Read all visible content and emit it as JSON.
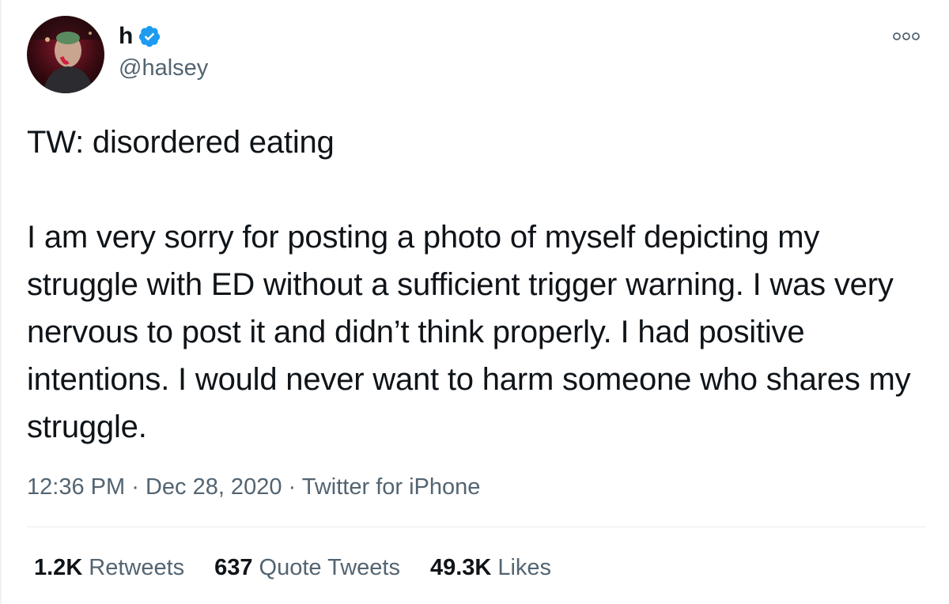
{
  "author": {
    "display_name": "h",
    "handle": "@halsey",
    "verified": true,
    "verified_color": "#1d9bf0",
    "avatar": "profile-photo"
  },
  "tweet": {
    "text": "TW: disordered eating\n\nI am very sorry for posting a photo of myself depicting my struggle with ED without a sufficient trigger warning. I was very nervous to post it and didn’t think properly. I had positive intentions. I would never want to harm someone who shares my struggle.",
    "time": "12:36 PM",
    "separator": "·",
    "date": "Dec 28, 2020",
    "source": "Twitter for iPhone"
  },
  "stats": {
    "retweets_count": "1.2K",
    "retweets_label": "Retweets",
    "quote_count": "637",
    "quote_label": "Quote Tweets",
    "likes_count": "49.3K",
    "likes_label": "Likes"
  },
  "icons": {
    "more": "more-options-icon",
    "verified": "verified-badge-icon"
  },
  "colors": {
    "text": "#0f1419",
    "secondary": "#536471",
    "divider": "#e6ecf0"
  }
}
